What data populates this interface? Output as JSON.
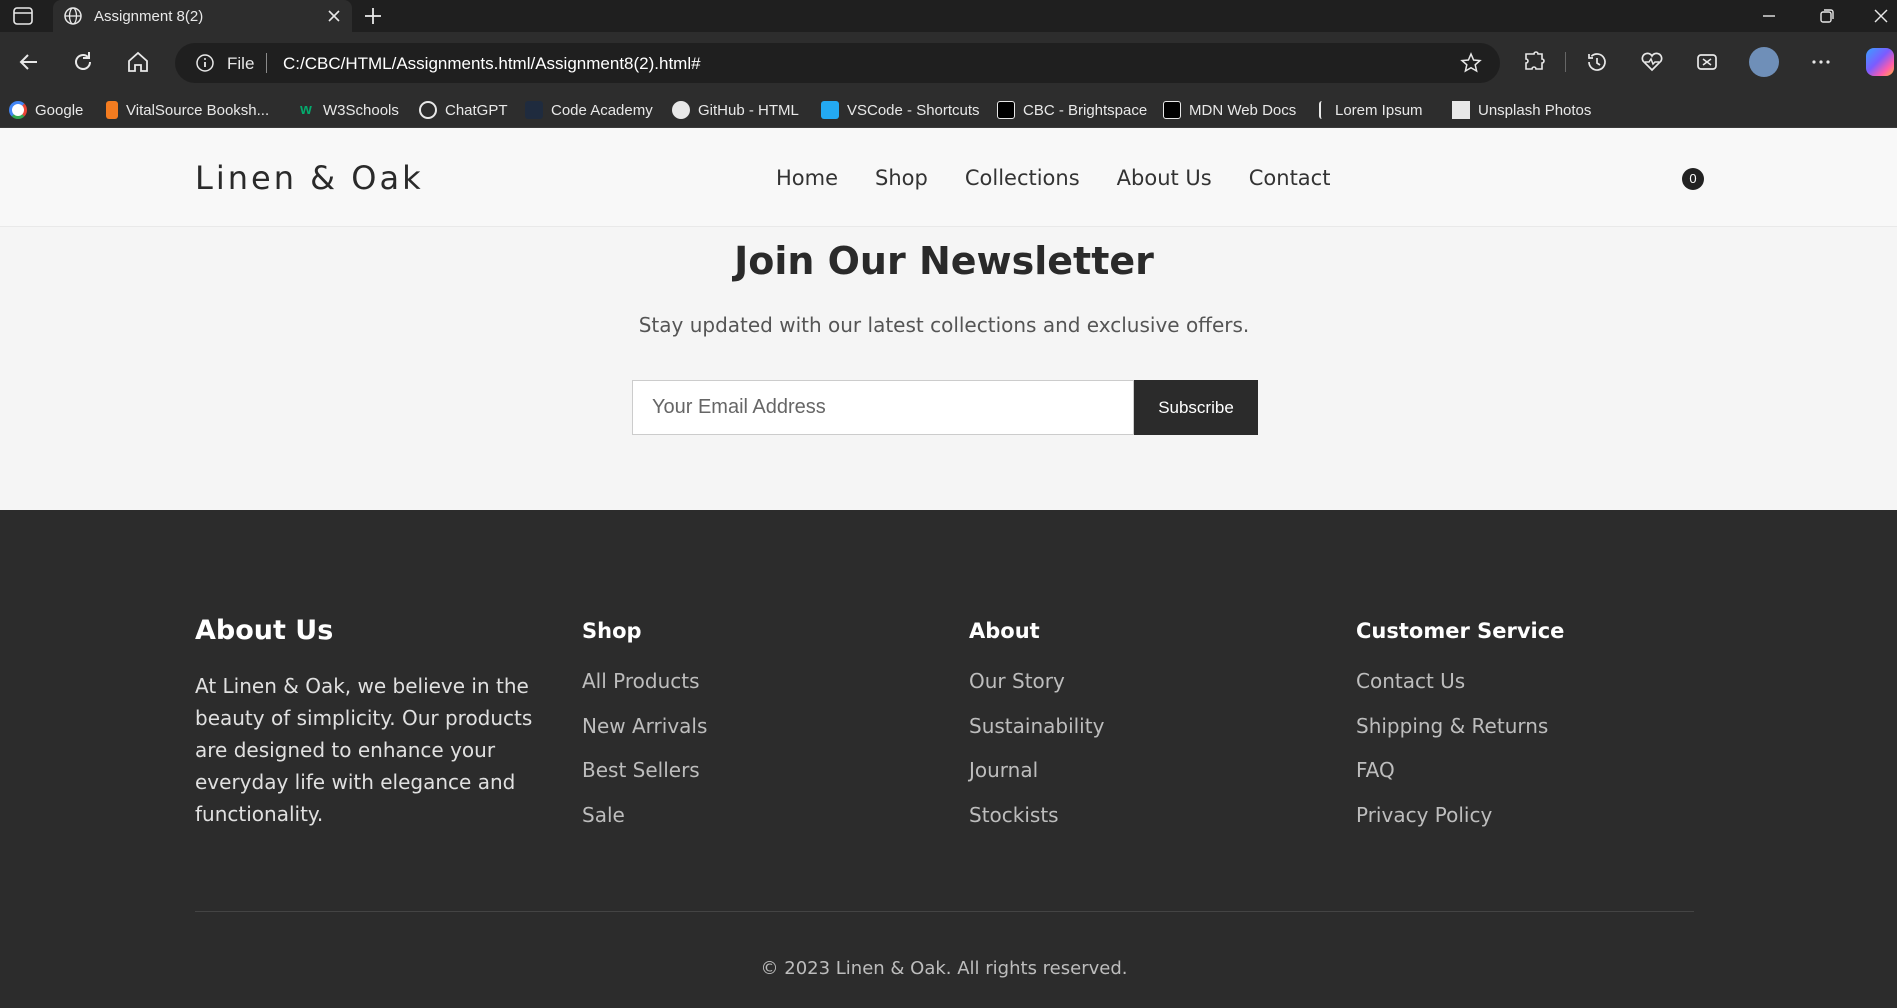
{
  "browser": {
    "tab_title": "Assignment 8(2)",
    "address_prefix": "File",
    "url": "C:/CBC/HTML/Assignments.html/Assignment8(2).html#",
    "bookmarks": [
      {
        "label": "Google",
        "icon": "google-icon",
        "color": "#4285f4"
      },
      {
        "label": "VitalSource Booksh...",
        "icon": "vitalsource-icon",
        "color": "#f47c20"
      },
      {
        "label": "W3Schools",
        "icon": "w3schools-icon",
        "color": "#04aa6d"
      },
      {
        "label": "ChatGPT",
        "icon": "chatgpt-icon",
        "color": "#e8e8e8"
      },
      {
        "label": "Code Academy",
        "icon": "codecademy-icon",
        "color": "#1f2b3e"
      },
      {
        "label": "GitHub - HTML",
        "icon": "github-icon",
        "color": "#e8e8e8"
      },
      {
        "label": "VSCode - Shortcuts",
        "icon": "vscode-icon",
        "color": "#23a9f2"
      },
      {
        "label": "CBC - Brightspace",
        "icon": "d2l-icon",
        "color": "#000000"
      },
      {
        "label": "MDN Web Docs",
        "icon": "mdn-icon",
        "color": "#000000"
      },
      {
        "label": "Lorem Ipsum",
        "icon": "lorem-icon",
        "color": "#e8e8e8"
      },
      {
        "label": "Unsplash Photos",
        "icon": "unsplash-icon",
        "color": "#e8e8e8"
      }
    ]
  },
  "site": {
    "logo": "Linen & Oak",
    "nav": [
      "Home",
      "Shop",
      "Collections",
      "About Us",
      "Contact"
    ],
    "cart_count": "0"
  },
  "newsletter": {
    "title": "Join Our Newsletter",
    "subtitle": "Stay updated with our latest collections and exclusive offers.",
    "email_placeholder": "Your Email Address",
    "button": "Subscribe"
  },
  "footer": {
    "about_title": "About Us",
    "about_text": "At Linen & Oak, we believe in the beauty of simplicity. Our products are designed to enhance your everyday life with elegance and functionality.",
    "columns": [
      {
        "heading": "Shop",
        "links": [
          "All Products",
          "New Arrivals",
          "Best Sellers",
          "Sale"
        ]
      },
      {
        "heading": "About",
        "links": [
          "Our Story",
          "Sustainability",
          "Journal",
          "Stockists"
        ]
      },
      {
        "heading": "Customer Service",
        "links": [
          "Contact Us",
          "Shipping & Returns",
          "FAQ",
          "Privacy Policy"
        ]
      }
    ],
    "copyright": "© 2023 Linen & Oak. All rights reserved."
  }
}
